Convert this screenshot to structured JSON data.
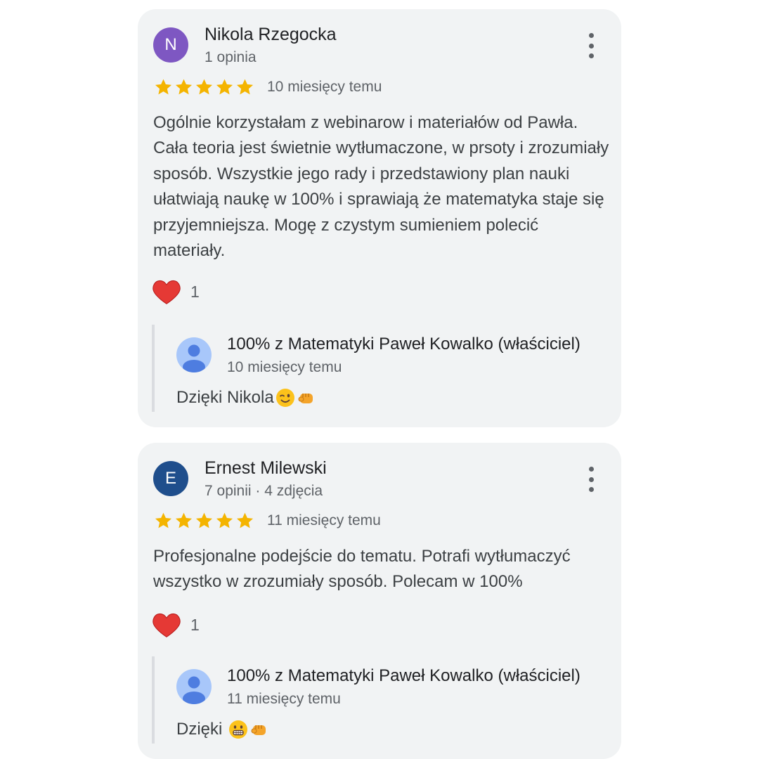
{
  "reviews": [
    {
      "avatar_letter": "N",
      "avatar_color": "#7e57c2",
      "name": "Nikola Rzegocka",
      "meta": "1 opinia",
      "rating": 5,
      "time": "10 miesięcy temu",
      "text": "Ogólnie korzystałam z webinarow i materiałów od Pawła. Cała teoria jest świetnie wytłumaczone, w prsoty i zrozumiały sposób. Wszystkie jego rady i przedstawiony plan nauki ułatwiają naukę w 100% i sprawiają że matematyka staje się przyjemniejsza. Mogę z czystym sumieniem polecić materiały.",
      "reaction_count": "1",
      "reply": {
        "name": "100% z Matematyki Paweł Kowalko (właściciel)",
        "time": "10 miesięcy temu",
        "text": "Dzięki Nikola",
        "emojis": [
          "winking-face",
          "fist-bump"
        ]
      }
    },
    {
      "avatar_letter": "E",
      "avatar_color": "#1f4e8c",
      "name": "Ernest Milewski",
      "meta": "7 opinii · 4 zdjęcia",
      "rating": 5,
      "time": "11 miesięcy temu",
      "text": "Profesjonalne podejście do tematu. Potrafi wytłumaczyć wszystko w zrozumiały sposób. Polecam w 100%",
      "reaction_count": "1",
      "reply": {
        "name": "100% z Matematyki Paweł Kowalko (właściciel)",
        "time": "11 miesięcy temu",
        "text": "Dzięki ",
        "emojis": [
          "grinning-face",
          "fist-bump"
        ]
      }
    }
  ],
  "colors": {
    "card_background": "#f1f3f4",
    "star": "#f4b400",
    "heart": "#e53935",
    "secondary_text": "#5f6368",
    "reply_avatar": "#a8c7fa"
  }
}
